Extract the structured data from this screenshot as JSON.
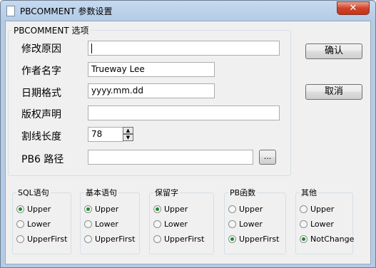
{
  "window": {
    "title": "PBCOMMENT 参数设置",
    "close_label": "✕"
  },
  "main_group": {
    "legend": "PBCOMMENT 选项",
    "fields": {
      "reason": {
        "label": "修改原因",
        "value": ""
      },
      "author": {
        "label": "作者名字",
        "value": "Trueway Lee"
      },
      "date_format": {
        "label": "日期格式",
        "value": "yyyy.mm.dd"
      },
      "copyright": {
        "label": "版权声明",
        "value": ""
      },
      "line_length": {
        "label": "割线长度",
        "value": "78"
      },
      "pb6_path": {
        "label": "PB6 路径",
        "value": "",
        "browse_label": "..."
      }
    }
  },
  "buttons": {
    "ok": "确认",
    "cancel": "取消"
  },
  "groups": [
    {
      "legend": "SQL语句",
      "options": [
        "Upper",
        "Lower",
        "UpperFirst"
      ],
      "selected": "Upper"
    },
    {
      "legend": "基本语句",
      "options": [
        "Upper",
        "Lower",
        "UpperFirst"
      ],
      "selected": "Upper"
    },
    {
      "legend": "保留字",
      "options": [
        "Upper",
        "Lower",
        "UpperFirst"
      ],
      "selected": "Upper"
    },
    {
      "legend": "PB函数",
      "options": [
        "Upper",
        "Lower",
        "UpperFirst"
      ],
      "selected": "UpperFirst"
    },
    {
      "legend": "其他",
      "options": [
        "Upper",
        "Lower",
        "NotChange"
      ],
      "selected": "NotChange"
    }
  ]
}
